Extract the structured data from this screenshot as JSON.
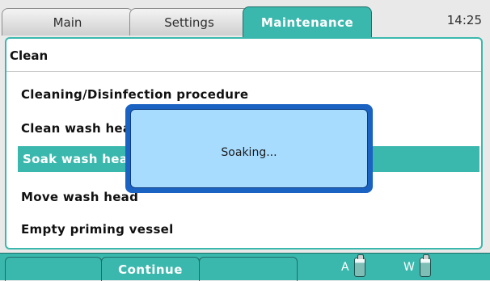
{
  "tabs": [
    {
      "label": "Main",
      "active": false
    },
    {
      "label": "Settings",
      "active": false
    },
    {
      "label": "Maintenance",
      "active": true
    }
  ],
  "clock": "14:25",
  "panel": {
    "title": "Clean",
    "items": [
      {
        "label": "Cleaning/Disinfection procedure"
      },
      {
        "label": "Clean wash head"
      },
      {
        "label": "Soak wash head",
        "selected": true
      },
      {
        "label": "Move wash head"
      },
      {
        "label": "Empty priming vessel"
      }
    ]
  },
  "dialog": {
    "message": "Soaking..."
  },
  "softkeys": [
    "",
    "Continue",
    ""
  ],
  "status": {
    "a_label": "A",
    "w_label": "W"
  },
  "colors": {
    "accent": "#3bb8ad",
    "dialog_border": "#1b63c2",
    "dialog_fill": "#a8dcff"
  }
}
